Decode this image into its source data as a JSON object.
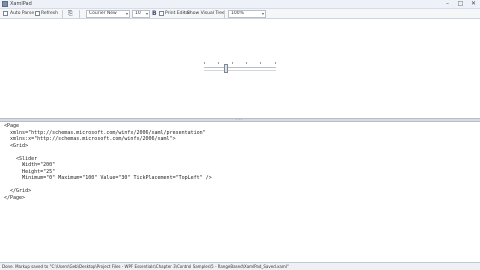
{
  "window": {
    "title": "XamlPad",
    "minimize_glyph": "–",
    "maximize_glyph": "□",
    "close_glyph": "✕"
  },
  "toolbar": {
    "auto_parse_label": "Auto Parse",
    "refresh_label": "Refresh",
    "copy_glyph": "⎘",
    "font_family_value": "Courier New",
    "font_size_value": "10",
    "bold_glyph": "B",
    "print_label": "Print Editor",
    "show_visual_tree_label": "Show Visual Tree",
    "zoom_value": "100%"
  },
  "preview": {
    "slider": {
      "minimum": 0,
      "maximum": 100,
      "value": 30,
      "tick_placement": "TopLeft"
    }
  },
  "editor": {
    "lines": [
      "<Page",
      "  xmlns=\"http://schemas.microsoft.com/winfx/2006/xaml/presentation\"",
      "  xmlns:x=\"http://schemas.microsoft.com/winfx/2006/xaml\">",
      "  <Grid>",
      "",
      "    <Slider",
      "      Width=\"200\"",
      "      Height=\"25\"",
      "      Minimum=\"0\" Maximum=\"100\" Value=\"30\" TickPlacement=\"TopLeft\" />",
      "",
      "  </Grid>",
      "</Page>"
    ]
  },
  "status": {
    "text": "Done. Markup saved to \"C:\\Users\\Geb\\Desktop\\Project Files - WPF Essentials\\Chapter 3\\Control Samples\\5 - RangeBased\\XamlPad_Saved.xaml\""
  },
  "colors": {
    "title_bar": "#eef2f8",
    "toolbar": "#f5f6f8",
    "splitter": "#d7dbe1",
    "status_bar": "#eef0f3"
  }
}
